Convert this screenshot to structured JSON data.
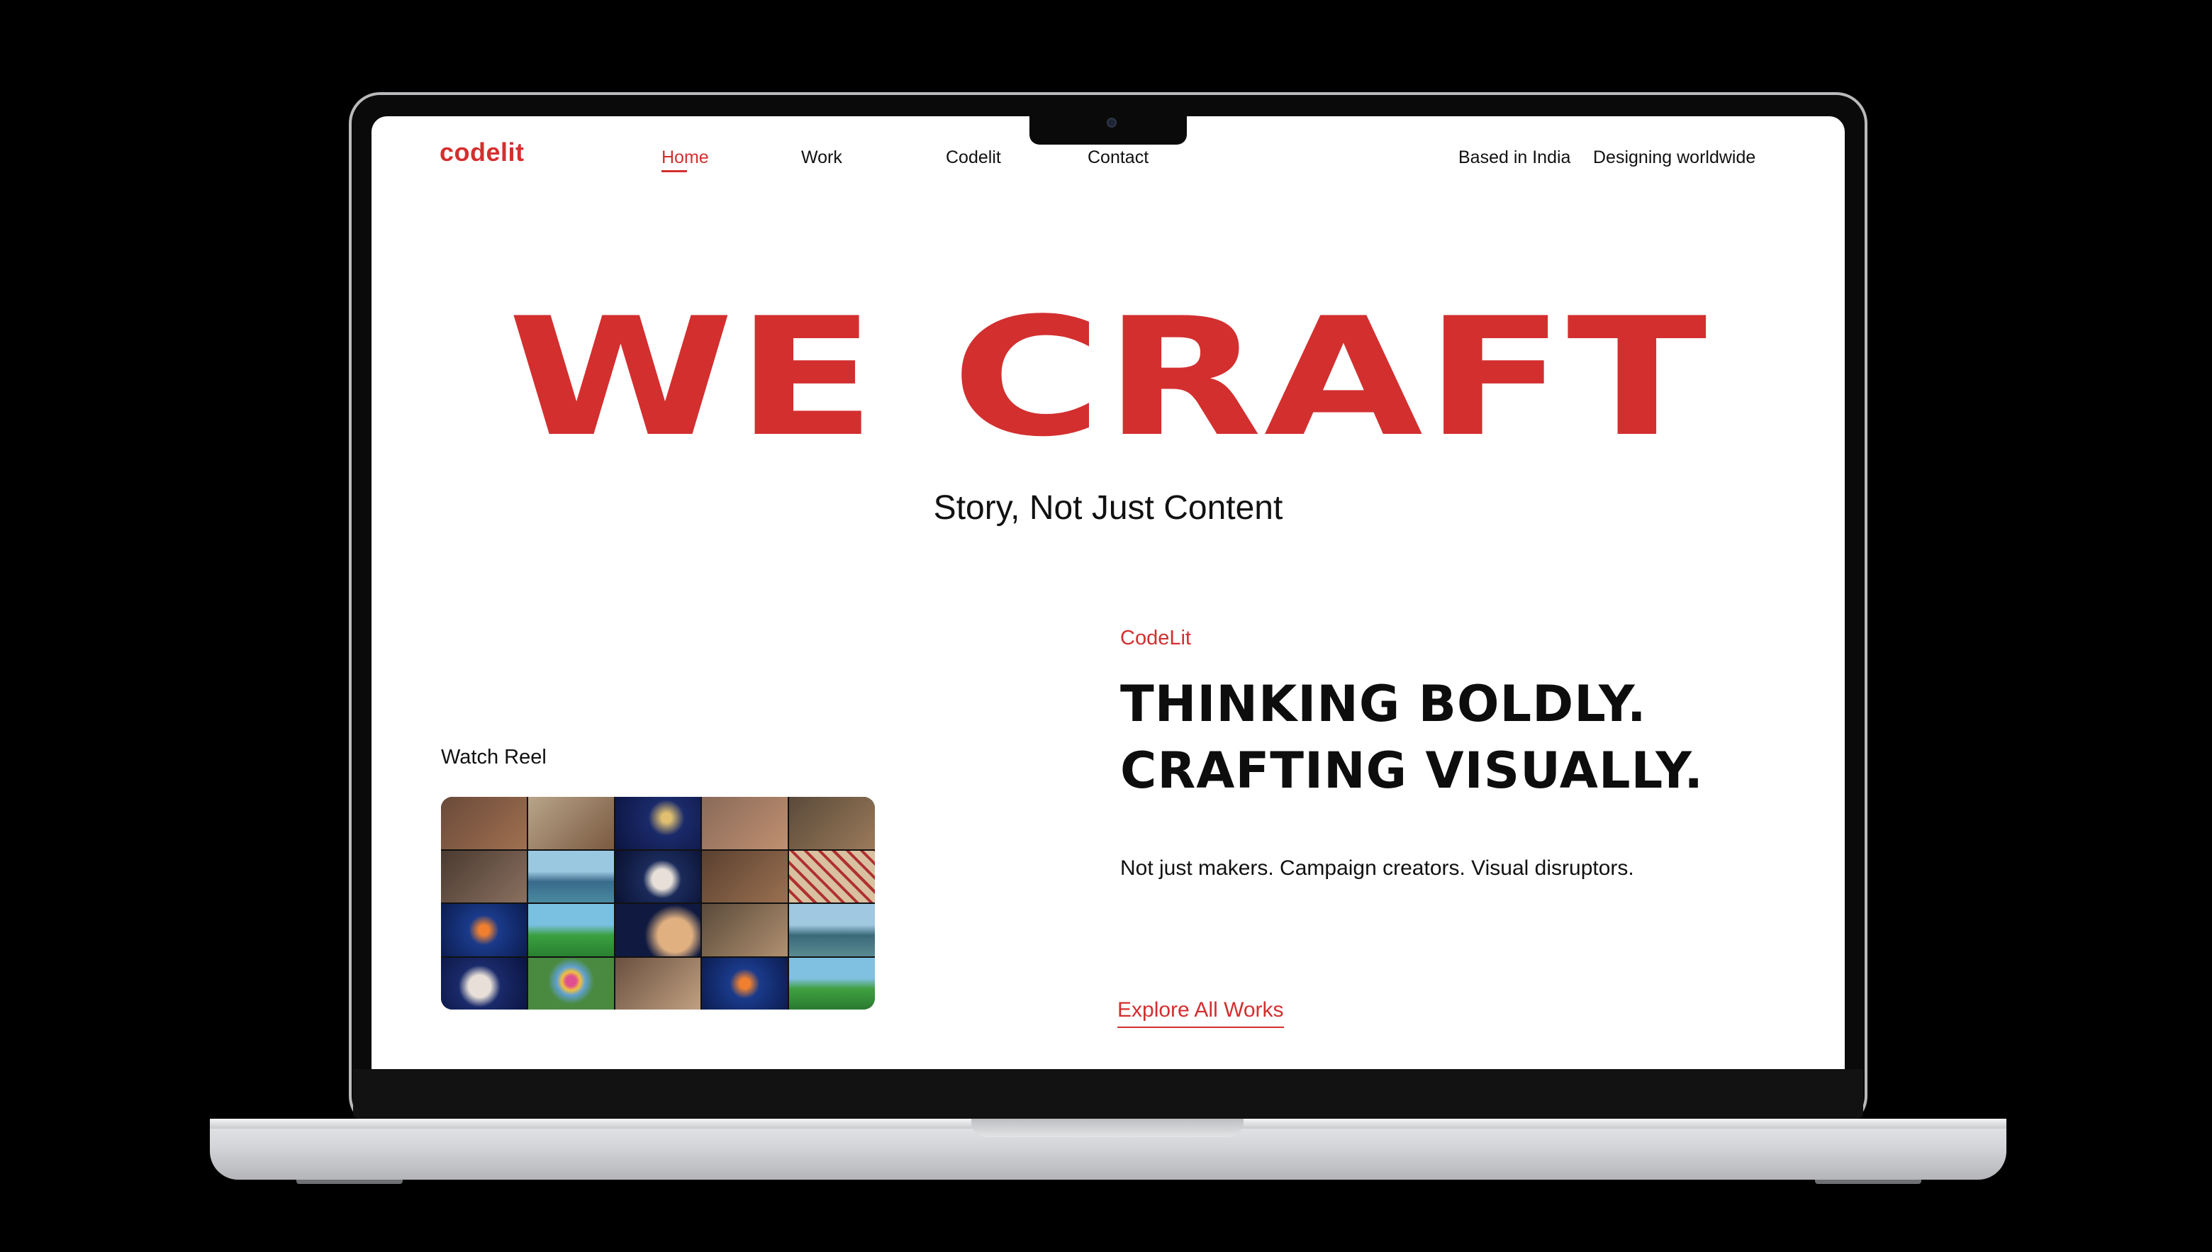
{
  "brand": {
    "logo_text": "codelit",
    "accent_color": "#d32f2f"
  },
  "nav": {
    "items": [
      {
        "label": "Home",
        "active": true
      },
      {
        "label": "Work",
        "active": false
      },
      {
        "label": "Codelit",
        "active": false
      },
      {
        "label": "Contact",
        "active": false
      }
    ]
  },
  "header": {
    "location": "Based in India",
    "reach": "Designing worldwide"
  },
  "hero": {
    "title": "WE CRAFT",
    "subtitle": "Story, Not  Just Content"
  },
  "reel": {
    "label": "Watch Reel",
    "thumbnail_icon": "video-collage-thumbnail"
  },
  "about": {
    "eyebrow": "CodeLit",
    "headline_line1": "THINKING BOLDLY.",
    "headline_line2": "CRAFTING VISUALLY.",
    "body": "Not just makers. Campaign creators. Visual disruptors.",
    "cta": "Explore All Works"
  }
}
